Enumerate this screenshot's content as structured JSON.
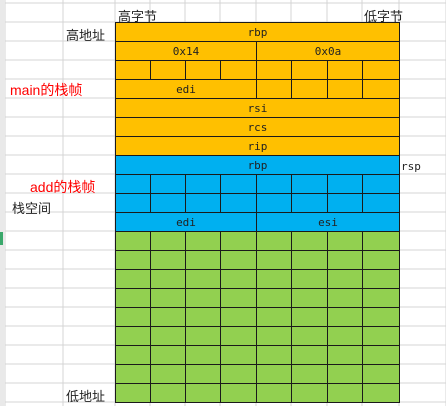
{
  "colors": {
    "main_frame": "#ffc000",
    "add_frame": "#00b0f0",
    "free_space": "#92d050",
    "cell_border": "#1a1a1a",
    "grid_line": "#d4d4d4",
    "frame_label": "#ff0000"
  },
  "header": {
    "high_byte": "高字节",
    "low_byte": "低字节"
  },
  "side": {
    "high_addr": "高地址",
    "low_addr": "低地址",
    "stack_space": "栈空间",
    "main_frame": "main的栈帧",
    "add_frame": "add的栈帧",
    "rsp": "rsp"
  },
  "stack": {
    "rows": [
      {
        "color": "main_frame",
        "type": "full",
        "label": "rbp"
      },
      {
        "color": "main_frame",
        "type": "half",
        "left": "0x14",
        "right": "0x0a"
      },
      {
        "color": "main_frame",
        "type": "bytes"
      },
      {
        "color": "main_frame",
        "type": "mixed",
        "left": "edi"
      },
      {
        "color": "main_frame",
        "type": "full",
        "label": "rsi"
      },
      {
        "color": "main_frame",
        "type": "full",
        "label": "rcs"
      },
      {
        "color": "main_frame",
        "type": "full",
        "label": "rip"
      },
      {
        "color": "add_frame",
        "type": "full",
        "label": "rbp"
      },
      {
        "color": "add_frame",
        "type": "bytes"
      },
      {
        "color": "add_frame",
        "type": "bytes"
      },
      {
        "color": "add_frame",
        "type": "half",
        "left": "edi",
        "right": "esi"
      },
      {
        "color": "free_space",
        "type": "bytes"
      },
      {
        "color": "free_space",
        "type": "bytes"
      },
      {
        "color": "free_space",
        "type": "bytes"
      },
      {
        "color": "free_space",
        "type": "bytes"
      },
      {
        "color": "free_space",
        "type": "bytes"
      },
      {
        "color": "free_space",
        "type": "bytes"
      },
      {
        "color": "free_space",
        "type": "bytes"
      },
      {
        "color": "free_space",
        "type": "bytes"
      },
      {
        "color": "free_space",
        "type": "bytes"
      }
    ]
  }
}
